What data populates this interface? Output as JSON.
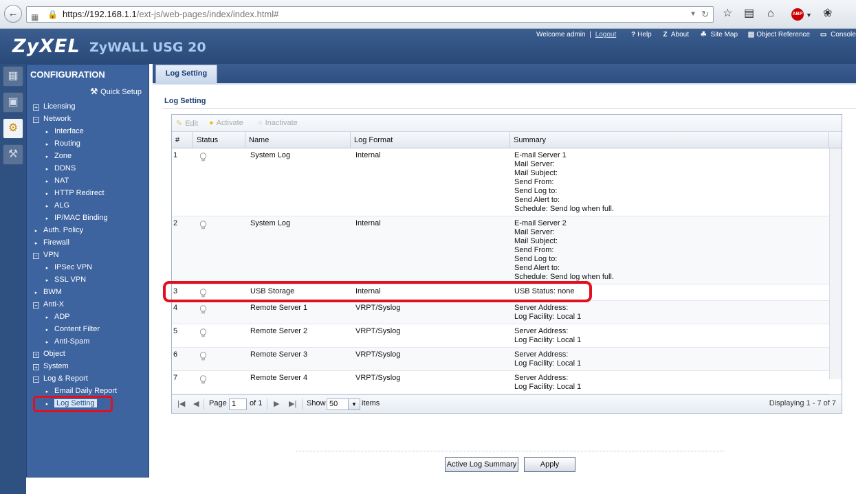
{
  "browser": {
    "url_host": "https://192.168.1.1",
    "url_path": "/ext-js/web-pages/index/index.html#"
  },
  "header": {
    "brand": "ZyXEL",
    "model": "ZyWALL USG 20",
    "welcome": "Welcome admin",
    "sep": "|",
    "logout": "Logout",
    "links": [
      {
        "icon": "?",
        "label": "Help"
      },
      {
        "icon": "Z",
        "label": "About"
      },
      {
        "icon": "☘",
        "label": "Site Map"
      },
      {
        "icon": "▤",
        "label": "Object Reference"
      },
      {
        "icon": "▭",
        "label": "Console"
      },
      {
        "icon": "C",
        "label": ""
      }
    ]
  },
  "sidebar": {
    "title": "CONFIGURATION",
    "quick_setup": "Quick Setup",
    "items": [
      {
        "label": "Licensing",
        "level": 0,
        "type": "plus"
      },
      {
        "label": "Network",
        "level": 0,
        "type": "minus"
      },
      {
        "label": "Interface",
        "level": 1,
        "type": "leaf"
      },
      {
        "label": "Routing",
        "level": 1,
        "type": "leaf"
      },
      {
        "label": "Zone",
        "level": 1,
        "type": "leaf"
      },
      {
        "label": "DDNS",
        "level": 1,
        "type": "leaf"
      },
      {
        "label": "NAT",
        "level": 1,
        "type": "leaf"
      },
      {
        "label": "HTTP Redirect",
        "level": 1,
        "type": "leaf"
      },
      {
        "label": "ALG",
        "level": 1,
        "type": "leaf"
      },
      {
        "label": "IP/MAC Binding",
        "level": 1,
        "type": "leaf"
      },
      {
        "label": "Auth. Policy",
        "level": 0,
        "type": "leaf"
      },
      {
        "label": "Firewall",
        "level": 0,
        "type": "leaf"
      },
      {
        "label": "VPN",
        "level": 0,
        "type": "minus"
      },
      {
        "label": "IPSec VPN",
        "level": 1,
        "type": "leaf"
      },
      {
        "label": "SSL VPN",
        "level": 1,
        "type": "leaf"
      },
      {
        "label": "BWM",
        "level": 0,
        "type": "leaf"
      },
      {
        "label": "Anti-X",
        "level": 0,
        "type": "minus"
      },
      {
        "label": "ADP",
        "level": 1,
        "type": "leaf"
      },
      {
        "label": "Content Filter",
        "level": 1,
        "type": "leaf"
      },
      {
        "label": "Anti-Spam",
        "level": 1,
        "type": "leaf"
      },
      {
        "label": "Object",
        "level": 0,
        "type": "plus"
      },
      {
        "label": "System",
        "level": 0,
        "type": "plus"
      },
      {
        "label": "Log & Report",
        "level": 0,
        "type": "minus"
      },
      {
        "label": "Email Daily Report",
        "level": 1,
        "type": "leaf"
      },
      {
        "label": "Log Setting",
        "level": 1,
        "type": "leaf",
        "selected": true
      }
    ]
  },
  "main": {
    "tab_label": "Log Setting",
    "section_title": "Log Setting",
    "toolbar": {
      "edit": "Edit",
      "activate": "Activate",
      "inactivate": "Inactivate"
    },
    "columns": [
      "#",
      "Status",
      "Name",
      "Log Format",
      "Summary"
    ],
    "rows": [
      {
        "num": "1",
        "name": "System Log",
        "format": "Internal",
        "summary": "E-mail Server 1\nMail Server:\nMail Subject:\nSend From:\nSend Log to:\nSend Alert to:\nSchedule: Send log when full."
      },
      {
        "num": "2",
        "name": "System Log",
        "format": "Internal",
        "summary": "E-mail Server 2\nMail Server:\nMail Subject:\nSend From:\nSend Log to:\nSend Alert to:\nSchedule: Send log when full."
      },
      {
        "num": "3",
        "name": "USB Storage",
        "format": "Internal",
        "summary": "USB Status: none"
      },
      {
        "num": "4",
        "name": "Remote Server 1",
        "format": "VRPT/Syslog",
        "summary": "Server Address:\nLog Facility: Local 1"
      },
      {
        "num": "5",
        "name": "Remote Server 2",
        "format": "VRPT/Syslog",
        "summary": "Server Address:\nLog Facility: Local 1"
      },
      {
        "num": "6",
        "name": "Remote Server 3",
        "format": "VRPT/Syslog",
        "summary": "Server Address:\nLog Facility: Local 1"
      },
      {
        "num": "7",
        "name": "Remote Server 4",
        "format": "VRPT/Syslog",
        "summary": "Server Address:\nLog Facility: Local 1"
      }
    ],
    "pager": {
      "page_label": "Page",
      "page_value": "1",
      "of_label": "of 1",
      "show_label": "Show",
      "show_value": "50",
      "items_label": "items",
      "displaying": "Displaying 1 - 7 of 7"
    },
    "buttons": {
      "active_log_summary": "Active Log Summary",
      "apply": "Apply"
    }
  },
  "colors": {
    "highlight": "#e01020",
    "header_bg": "#2f5181",
    "sidebar_bg": "#3e64a0"
  }
}
